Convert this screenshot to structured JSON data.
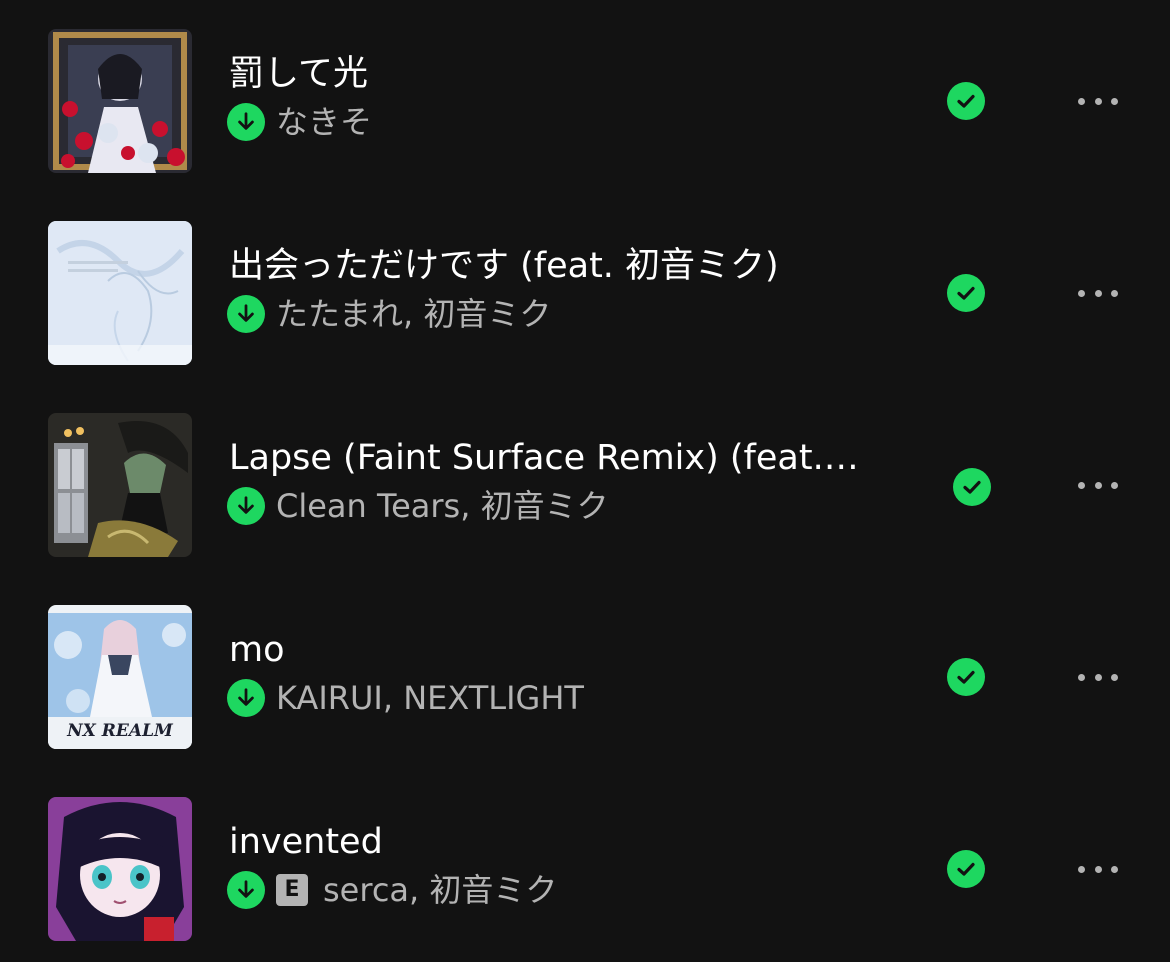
{
  "tracks": [
    {
      "title": "罰して光",
      "artists": "なきそ",
      "explicit": false,
      "downloaded": true,
      "liked": true,
      "art_icon": "album-art-dark-gothic-flowers"
    },
    {
      "title": "出会っただけです (feat. 初音ミク)",
      "artists": "たたまれ, 初音ミク",
      "explicit": false,
      "downloaded": true,
      "liked": true,
      "art_icon": "album-art-pale-blue-sketch"
    },
    {
      "title": "Lapse (Faint Surface Remix) (feat.…",
      "artists": "Clean Tears, 初音ミク",
      "explicit": false,
      "downloaded": true,
      "liked": true,
      "art_icon": "album-art-dark-room-figure"
    },
    {
      "title": "mo",
      "artists": "KAIRUI, NEXTLIGHT",
      "explicit": false,
      "downloaded": true,
      "liked": true,
      "art_icon": "album-art-nx-realm"
    },
    {
      "title": "invented",
      "artists": "serca, 初音ミク",
      "explicit": true,
      "explicit_label": "E",
      "downloaded": true,
      "liked": true,
      "art_icon": "album-art-purple-anime-face"
    }
  ],
  "colors": {
    "background": "#121212",
    "accent_green": "#1ed760",
    "title_text": "#ffffff",
    "secondary_text": "#b3b3b3"
  },
  "icons": {
    "download": "download-arrow-icon",
    "liked": "check-circle-icon",
    "more": "more-options-icon"
  }
}
